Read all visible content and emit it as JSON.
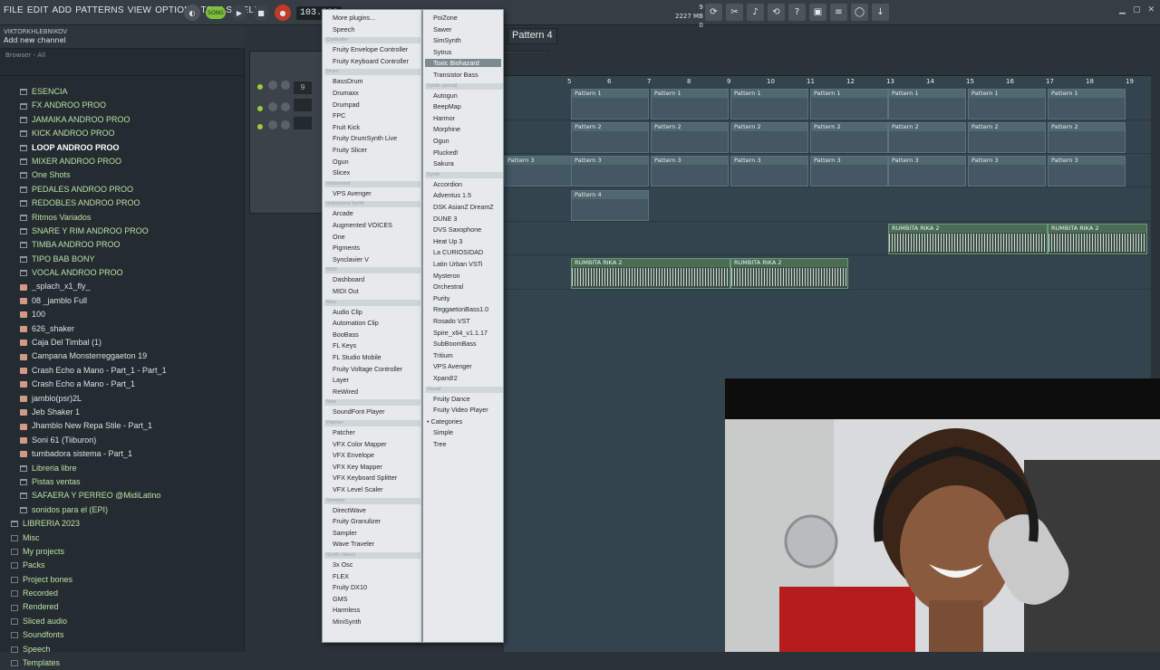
{
  "menubar": [
    "FILE",
    "EDIT",
    "ADD",
    "PATTERNS",
    "VIEW",
    "OPTIONS",
    "TOOLS",
    "HELP"
  ],
  "hint": {
    "user": "VIKTORKHLEBNIKOV",
    "text": "Add new channel"
  },
  "transport": {
    "song": "SONG",
    "tempo": "103.000"
  },
  "cpu": {
    "a": "9",
    "b": "2227 MB",
    "c": "0"
  },
  "pattern_selector": "Pattern 4",
  "browser": {
    "header": "Browser - All",
    "items": [
      {
        "label": "ESENCIA",
        "type": "folder",
        "style": "green"
      },
      {
        "label": "FX ANDROO PROO",
        "type": "folder",
        "style": "green"
      },
      {
        "label": "JAMAIKA ANDROO PROO",
        "type": "folder",
        "style": "green"
      },
      {
        "label": "KICK ANDROO PROO",
        "type": "folder",
        "style": "green"
      },
      {
        "label": "LOOP ANDROO PROO",
        "type": "folder",
        "style": "hi"
      },
      {
        "label": "MIXER ANDROO PROO",
        "type": "folder",
        "style": "green"
      },
      {
        "label": "One Shots",
        "type": "folder",
        "style": "green"
      },
      {
        "label": "PEDALES ANDROO PROO",
        "type": "folder",
        "style": "green"
      },
      {
        "label": "REDOBLES ANDROO PROO",
        "type": "folder",
        "style": "green"
      },
      {
        "label": "Ritmos Variados",
        "type": "folder",
        "style": "green"
      },
      {
        "label": "SNARE Y RIM  ANDROO PROO",
        "type": "folder",
        "style": "green"
      },
      {
        "label": "TIMBA ANDROO PROO",
        "type": "folder",
        "style": "green"
      },
      {
        "label": "TIPO BAB BONY",
        "type": "folder",
        "style": "green"
      },
      {
        "label": "VOCAL ANDROO PROO",
        "type": "folder",
        "style": "green"
      },
      {
        "label": "_splach_x1_fly_",
        "type": "audio",
        "style": "lt"
      },
      {
        "label": "08 _jamblo Full",
        "type": "audio",
        "style": "lt"
      },
      {
        "label": "100",
        "type": "audio",
        "style": "lt"
      },
      {
        "label": "626_shaker",
        "type": "audio",
        "style": "lt"
      },
      {
        "label": "Caja Del Timbal (1)",
        "type": "audio",
        "style": "lt"
      },
      {
        "label": "Campana Monsterreggaeton  19",
        "type": "audio",
        "style": "lt"
      },
      {
        "label": "Crash Echo a Mano - Part_1 - Part_1",
        "type": "audio",
        "style": "lt"
      },
      {
        "label": "Crash Echo a Mano - Part_1",
        "type": "audio",
        "style": "lt"
      },
      {
        "label": "jamblo(psr)2L",
        "type": "audio",
        "style": "lt"
      },
      {
        "label": "Jeb Shaker 1",
        "type": "audio",
        "style": "lt"
      },
      {
        "label": "Jhamblo New Repa Stile - Part_1",
        "type": "audio",
        "style": "lt"
      },
      {
        "label": "Soni 61 (Tiiburon)",
        "type": "audio",
        "style": "lt"
      },
      {
        "label": "tumbadora sistema - Part_1",
        "type": "audio",
        "style": "lt"
      },
      {
        "label": "Libreria libre",
        "type": "folder",
        "style": "green"
      },
      {
        "label": "Pistas ventas",
        "type": "folder",
        "style": "green"
      },
      {
        "label": "SAFAERA Y PERREO @MidiLatino",
        "type": "folder",
        "style": "green"
      },
      {
        "label": "sonidos para el (EPI)",
        "type": "folder",
        "style": "green"
      },
      {
        "label": "LIBRERIA 2023",
        "type": "folder",
        "style": "green"
      },
      {
        "label": "Misc",
        "type": "dsec",
        "style": "green"
      },
      {
        "label": "My projects",
        "type": "dsec",
        "style": "green"
      },
      {
        "label": "Packs",
        "type": "dsec",
        "style": "green"
      },
      {
        "label": "Project bones",
        "type": "dsec",
        "style": "green"
      },
      {
        "label": "Recorded",
        "type": "dsec",
        "style": "green"
      },
      {
        "label": "Rendered",
        "type": "dsec",
        "style": "green"
      },
      {
        "label": "Sliced audio",
        "type": "dsec",
        "style": "green"
      },
      {
        "label": "Soundfonts",
        "type": "dsec",
        "style": "green"
      },
      {
        "label": "Speech",
        "type": "dsec",
        "style": "green"
      },
      {
        "label": "Templates",
        "type": "dsec",
        "style": "green"
      }
    ]
  },
  "rack": {
    "row1_num": "9"
  },
  "ruler": [
    "5",
    "6",
    "7",
    "8",
    "9",
    "10",
    "11",
    "12",
    "13",
    "14",
    "15",
    "16",
    "17",
    "18",
    "19"
  ],
  "playlist": {
    "p1": "Pattern 1",
    "p2": "Pattern 2",
    "p3": "Pattern 3",
    "p4": "Pattern 4",
    "audio": "RUMBITA RIKA 2"
  },
  "menu1": [
    {
      "t": "item",
      "label": "More plugins..."
    },
    {
      "t": "item",
      "label": "Speech"
    },
    {
      "t": "head",
      "label": "Controller"
    },
    {
      "t": "item",
      "label": "Fruity Envelope Controller"
    },
    {
      "t": "item",
      "label": "Fruity Keyboard Controller"
    },
    {
      "t": "head",
      "label": "Drum"
    },
    {
      "t": "item",
      "label": "BassDrum"
    },
    {
      "t": "item",
      "label": "Drumaxx"
    },
    {
      "t": "item",
      "label": "Drumpad"
    },
    {
      "t": "item",
      "label": "FPC"
    },
    {
      "t": "item",
      "label": "Fruit Kick"
    },
    {
      "t": "item",
      "label": "Fruity DrumSynth Live"
    },
    {
      "t": "item",
      "label": "Fruity Slicer"
    },
    {
      "t": "item",
      "label": "Ogun"
    },
    {
      "t": "item",
      "label": "Slicex"
    },
    {
      "t": "head",
      "label": "Instrument"
    },
    {
      "t": "item",
      "label": "VPS Avenger"
    },
    {
      "t": "head",
      "label": "Instrument Synth"
    },
    {
      "t": "item",
      "label": "Arcade"
    },
    {
      "t": "item",
      "label": "Augmented VOICES"
    },
    {
      "t": "item",
      "label": "One"
    },
    {
      "t": "item",
      "label": "Pigments"
    },
    {
      "t": "item",
      "label": "Synclavier V"
    },
    {
      "t": "head",
      "label": "MIDI"
    },
    {
      "t": "item",
      "label": "Dashboard"
    },
    {
      "t": "item",
      "label": "MIDI Out"
    },
    {
      "t": "head",
      "label": "Misc"
    },
    {
      "t": "item",
      "label": "Audio Clip"
    },
    {
      "t": "item",
      "label": "Automation Clip"
    },
    {
      "t": "item",
      "label": "BooBass"
    },
    {
      "t": "item",
      "label": "FL Keys"
    },
    {
      "t": "item",
      "label": "FL Studio Mobile"
    },
    {
      "t": "item",
      "label": "Fruity Voltage Controller"
    },
    {
      "t": "item",
      "label": "Layer"
    },
    {
      "t": "item",
      "label": "ReWired"
    },
    {
      "t": "head",
      "label": "New"
    },
    {
      "t": "item",
      "label": "SoundFont Player"
    },
    {
      "t": "head",
      "label": "Patcher"
    },
    {
      "t": "item",
      "label": "Patcher"
    },
    {
      "t": "item",
      "label": "VFX Color Mapper"
    },
    {
      "t": "item",
      "label": "VFX Envelope"
    },
    {
      "t": "item",
      "label": "VFX Key Mapper"
    },
    {
      "t": "item",
      "label": "VFX Keyboard Splitter"
    },
    {
      "t": "item",
      "label": "VFX Level Scaler"
    },
    {
      "t": "head",
      "label": "Sampler"
    },
    {
      "t": "item",
      "label": "DirectWave"
    },
    {
      "t": "item",
      "label": "Fruity Granulizer"
    },
    {
      "t": "item",
      "label": "Sampler"
    },
    {
      "t": "item",
      "label": "Wave Traveler"
    },
    {
      "t": "head",
      "label": "Synth classic"
    },
    {
      "t": "item",
      "label": "3x Osc"
    },
    {
      "t": "item",
      "label": "FLEX"
    },
    {
      "t": "item",
      "label": "Fruity DX10"
    },
    {
      "t": "item",
      "label": "GMS"
    },
    {
      "t": "item",
      "label": "Harmless"
    },
    {
      "t": "item",
      "label": "MiniSynth"
    }
  ],
  "menu2": [
    {
      "t": "item",
      "label": "PoiZone"
    },
    {
      "t": "item",
      "label": "Sawer"
    },
    {
      "t": "item",
      "label": "SimSynth"
    },
    {
      "t": "item",
      "label": "Sytrus"
    },
    {
      "t": "sel",
      "label": "Toxic Biohazard"
    },
    {
      "t": "item",
      "label": "Transistor Bass"
    },
    {
      "t": "head",
      "label": "Synth special"
    },
    {
      "t": "item",
      "label": "Autogun"
    },
    {
      "t": "item",
      "label": "BeepMap"
    },
    {
      "t": "item",
      "label": "Harmor"
    },
    {
      "t": "item",
      "label": "Morphine"
    },
    {
      "t": "item",
      "label": "Ogun"
    },
    {
      "t": "item",
      "label": "Plucked!"
    },
    {
      "t": "item",
      "label": "Sakura"
    },
    {
      "t": "head",
      "label": "Synth"
    },
    {
      "t": "item",
      "label": "Accordion"
    },
    {
      "t": "item",
      "label": "Adventus 1.5"
    },
    {
      "t": "item",
      "label": "DSK AsianZ DreamZ"
    },
    {
      "t": "item",
      "label": "DUNE 3"
    },
    {
      "t": "item",
      "label": "DVS Saxophone"
    },
    {
      "t": "item",
      "label": "Heat Up 3"
    },
    {
      "t": "item",
      "label": "La CURIOSIDAD"
    },
    {
      "t": "item",
      "label": "Latin Urban VSTi"
    },
    {
      "t": "item",
      "label": "Mysteron"
    },
    {
      "t": "item",
      "label": "Orchestral"
    },
    {
      "t": "item",
      "label": "Purity"
    },
    {
      "t": "item",
      "label": "ReggaetonBass1.0"
    },
    {
      "t": "item",
      "label": "Rosado VST"
    },
    {
      "t": "item",
      "label": "Spire_x64_v1.1.17"
    },
    {
      "t": "item",
      "label": "SubBoomBass"
    },
    {
      "t": "item",
      "label": "Tritium"
    },
    {
      "t": "item",
      "label": "VPS Avenger"
    },
    {
      "t": "item",
      "label": "Xpand!2"
    },
    {
      "t": "head",
      "label": "Visual"
    },
    {
      "t": "item",
      "label": "Fruity Dance"
    },
    {
      "t": "item",
      "label": "Fruity Video Player"
    },
    {
      "t": "radio",
      "label": "Categories"
    },
    {
      "t": "item",
      "label": "Simple"
    },
    {
      "t": "item",
      "label": "Tree"
    }
  ]
}
